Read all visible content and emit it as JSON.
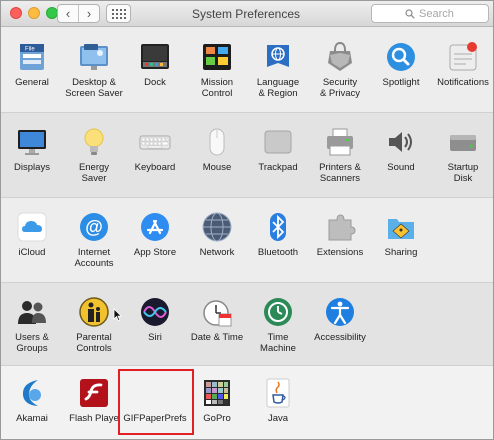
{
  "window": {
    "title": "System Preferences",
    "search_placeholder": "Search",
    "nav_back_glyph": "‹",
    "nav_forward_glyph": "›"
  },
  "rows": [
    [
      {
        "id": "general",
        "label": "General",
        "icon": "general-icon"
      },
      {
        "id": "desktop",
        "label": "Desktop &\nScreen Saver",
        "icon": "desktop-screensaver-icon"
      },
      {
        "id": "dock",
        "label": "Dock",
        "icon": "dock-icon"
      },
      {
        "id": "mission",
        "label": "Mission\nControl",
        "icon": "mission-control-icon"
      },
      {
        "id": "language",
        "label": "Language\n& Region",
        "icon": "language-region-icon"
      },
      {
        "id": "security",
        "label": "Security\n& Privacy",
        "icon": "security-privacy-icon"
      },
      {
        "id": "spotlight",
        "label": "Spotlight",
        "icon": "spotlight-icon"
      },
      {
        "id": "notifications",
        "label": "Notifications",
        "icon": "notifications-icon"
      }
    ],
    [
      {
        "id": "displays",
        "label": "Displays",
        "icon": "displays-icon"
      },
      {
        "id": "energy",
        "label": "Energy\nSaver",
        "icon": "energy-saver-icon"
      },
      {
        "id": "keyboard",
        "label": "Keyboard",
        "icon": "keyboard-icon"
      },
      {
        "id": "mouse",
        "label": "Mouse",
        "icon": "mouse-icon"
      },
      {
        "id": "trackpad",
        "label": "Trackpad",
        "icon": "trackpad-icon"
      },
      {
        "id": "printers",
        "label": "Printers &\nScanners",
        "icon": "printers-scanners-icon"
      },
      {
        "id": "sound",
        "label": "Sound",
        "icon": "sound-icon"
      },
      {
        "id": "startup",
        "label": "Startup\nDisk",
        "icon": "startup-disk-icon"
      }
    ],
    [
      {
        "id": "icloud",
        "label": "iCloud",
        "icon": "icloud-icon"
      },
      {
        "id": "internet",
        "label": "Internet\nAccounts",
        "icon": "internet-accounts-icon"
      },
      {
        "id": "appstore",
        "label": "App Store",
        "icon": "app-store-icon"
      },
      {
        "id": "network",
        "label": "Network",
        "icon": "network-icon"
      },
      {
        "id": "bluetooth",
        "label": "Bluetooth",
        "icon": "bluetooth-icon"
      },
      {
        "id": "extensions",
        "label": "Extensions",
        "icon": "extensions-icon"
      },
      {
        "id": "sharing",
        "label": "Sharing",
        "icon": "sharing-icon"
      }
    ],
    [
      {
        "id": "users",
        "label": "Users &\nGroups",
        "icon": "users-groups-icon"
      },
      {
        "id": "parental",
        "label": "Parental\nControls",
        "icon": "parental-controls-icon"
      },
      {
        "id": "siri",
        "label": "Siri",
        "icon": "siri-icon"
      },
      {
        "id": "datetime",
        "label": "Date & Time",
        "icon": "date-time-icon"
      },
      {
        "id": "timemachine",
        "label": "Time\nMachine",
        "icon": "time-machine-icon"
      },
      {
        "id": "accessibility",
        "label": "Accessibility",
        "icon": "accessibility-icon"
      }
    ],
    [
      {
        "id": "akamai",
        "label": "Akamai",
        "icon": "akamai-icon"
      },
      {
        "id": "flash",
        "label": "Flash Playe",
        "icon": "flash-player-icon"
      },
      {
        "id": "gifpaper",
        "label": "GIFPaperPrefs",
        "icon": ""
      },
      {
        "id": "gopro",
        "label": "GoPro",
        "icon": "gopro-icon"
      },
      {
        "id": "java",
        "label": "Java",
        "icon": "java-icon"
      }
    ]
  ],
  "highlight_color": "#e31e24"
}
